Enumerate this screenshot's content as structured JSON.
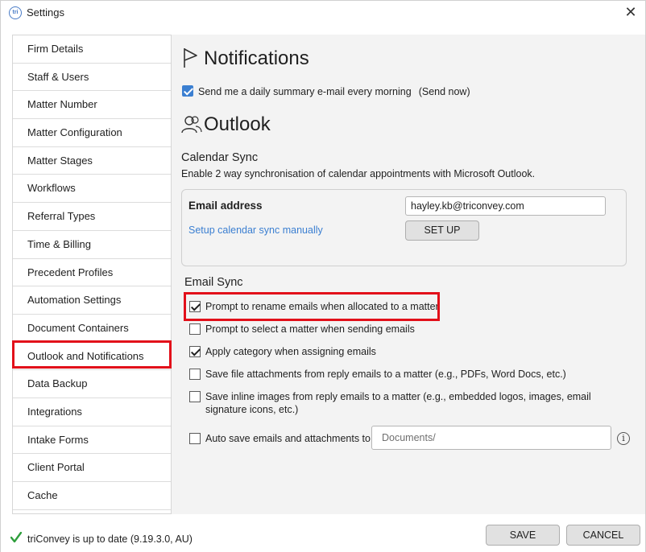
{
  "window": {
    "title": "Settings",
    "app_icon_text": "tri"
  },
  "sidebar": {
    "items": [
      {
        "label": "Firm Details"
      },
      {
        "label": "Staff & Users"
      },
      {
        "label": "Matter Number"
      },
      {
        "label": "Matter Configuration"
      },
      {
        "label": "Matter Stages"
      },
      {
        "label": "Workflows"
      },
      {
        "label": "Referral Types"
      },
      {
        "label": "Time & Billing"
      },
      {
        "label": "Precedent Profiles"
      },
      {
        "label": "Automation Settings"
      },
      {
        "label": "Document Containers"
      },
      {
        "label": "Outlook and Notifications"
      },
      {
        "label": "Data Backup"
      },
      {
        "label": "Integrations"
      },
      {
        "label": "Intake Forms"
      },
      {
        "label": "Client Portal"
      },
      {
        "label": "Cache"
      }
    ],
    "active_index": 11
  },
  "notifications": {
    "title": "Notifications",
    "daily_summary_label": "Send me a daily summary e-mail every morning",
    "daily_summary_checked": true,
    "send_now_link": "(Send now)"
  },
  "outlook": {
    "title": "Outlook",
    "calendar_sync": {
      "heading": "Calendar Sync",
      "description": "Enable 2 way synchronisation of calendar appointments with Microsoft Outlook.",
      "email_label": "Email address",
      "email_value": "hayley.kb@triconvey.com",
      "setup_link": "Setup calendar sync manually",
      "setup_button": "SET UP"
    },
    "email_sync": {
      "heading": "Email Sync",
      "options": [
        {
          "label": "Prompt to rename emails when allocated to a matter",
          "checked": true
        },
        {
          "label": "Prompt to select a matter when sending emails",
          "checked": false
        },
        {
          "label": "Apply category when assigning emails",
          "checked": true
        },
        {
          "label": "Save file attachments from reply emails to a matter (e.g., PDFs, Word Docs, etc.)",
          "checked": false
        },
        {
          "label": "Save inline images from reply emails to a matter (e.g., embedded logos, images, email signature icons, etc.)",
          "checked": false
        }
      ],
      "auto_save_label": "Auto save emails and attachments to:",
      "auto_save_checked": false,
      "auto_save_placeholder": "Documents/"
    }
  },
  "footer": {
    "status": "triConvey is up to date (9.19.3.0, AU)",
    "save_button": "SAVE",
    "cancel_button": "CANCEL"
  },
  "colors": {
    "highlight": "#e2101a",
    "link": "#3b7fd1",
    "status_check": "#2e9e3c"
  }
}
